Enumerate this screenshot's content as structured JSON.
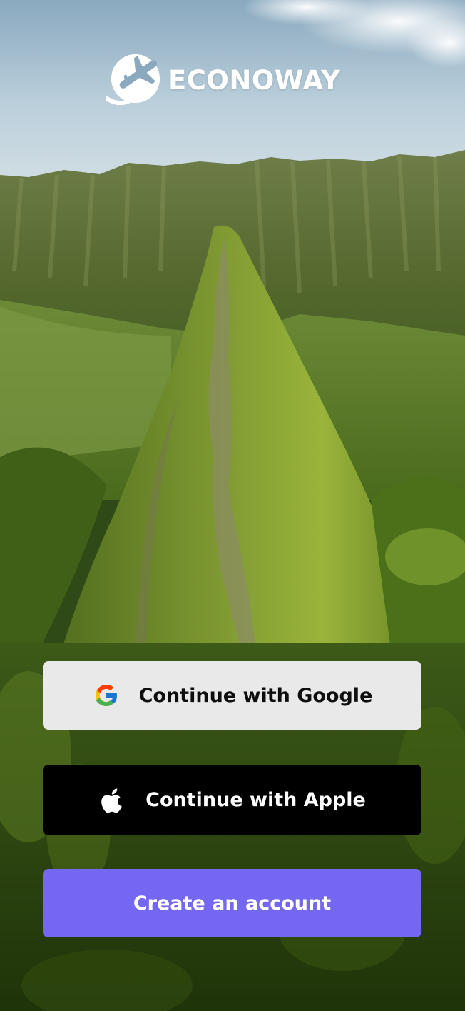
{
  "app": {
    "brand_name": "ECONOWAY",
    "logo_icon": "globe-airplane-icon"
  },
  "auth": {
    "google_label": "Continue with Google",
    "google_icon": "google-icon",
    "apple_label": "Continue with Apple",
    "apple_icon": "apple-icon",
    "create_label": "Create an account"
  },
  "colors": {
    "primary": "#7467f2",
    "google_button_bg": "#e9e9e9",
    "apple_button_bg": "#000000"
  }
}
